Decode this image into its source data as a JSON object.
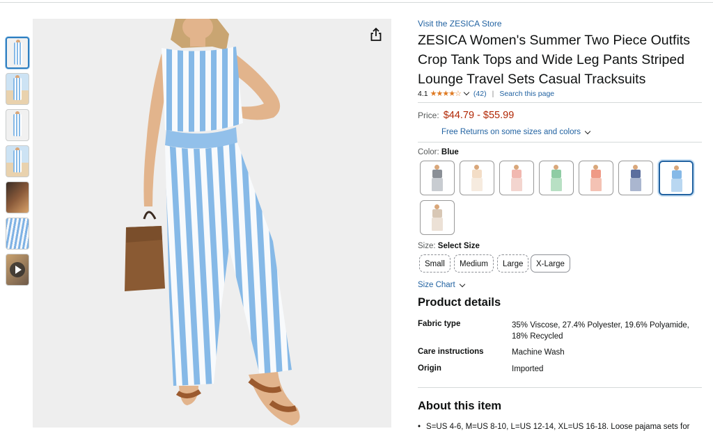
{
  "product": {
    "store_link": "Visit the ZESICA Store",
    "title": "ZESICA Women's Summer Two Piece Outfits Crop Tank Tops and Wide Leg Pants Striped Lounge Travel Sets Casual Tracksuits",
    "rating": "4.1",
    "stars_glyphs": "★★★★☆",
    "rating_value": 4.1,
    "review_count": "(42)",
    "search_link": "Search this page",
    "separator": "|"
  },
  "price": {
    "label": "Price:",
    "range": "$44.79 - $55.99",
    "returns": "Free Returns on some sizes and colors"
  },
  "color": {
    "label": "Color:",
    "selected": "Blue",
    "swatches": [
      {
        "name": "gray",
        "top": "#8a8f96",
        "pant": "#c8ccd1"
      },
      {
        "name": "cream",
        "top": "#f3ddc6",
        "pant": "#f6ebdf"
      },
      {
        "name": "pink",
        "top": "#f1b8b0",
        "pant": "#f3d5cf"
      },
      {
        "name": "green",
        "top": "#8fcca4",
        "pant": "#b8e0c4"
      },
      {
        "name": "coral",
        "top": "#ef9a86",
        "pant": "#f4c2b4"
      },
      {
        "name": "navy",
        "top": "#5c6f9e",
        "pant": "#aab6cf"
      },
      {
        "name": "blue",
        "top": "#86b9e7",
        "pant": "#b9d7f1"
      },
      {
        "name": "tan",
        "top": "#d8c7b5",
        "pant": "#ece1d6"
      }
    ]
  },
  "size": {
    "label": "Size:",
    "selected": "Select Size",
    "options": [
      "Small",
      "Medium",
      "Large",
      "X-Large"
    ],
    "chart_link": "Size Chart"
  },
  "details": {
    "heading": "Product details",
    "rows": [
      {
        "key": "Fabric type",
        "value": "35% Viscose, 27.4% Polyester, 19.6% Polyamide, 18% Recycled"
      },
      {
        "key": "Care instructions",
        "value": "Machine Wash"
      },
      {
        "key": "Origin",
        "value": "Imported"
      }
    ]
  },
  "about": {
    "heading": "About this item",
    "bullets": [
      "S=US 4-6, M=US 8-10, L=US 12-14, XL=US 16-18. Loose pajama sets for"
    ]
  },
  "colors": {
    "link": "#2162a1",
    "price": "#b12704",
    "star": "#de7921",
    "stripe_blue": "#86b9e7"
  },
  "icons": {
    "share": "share-icon",
    "play": "play-icon"
  }
}
